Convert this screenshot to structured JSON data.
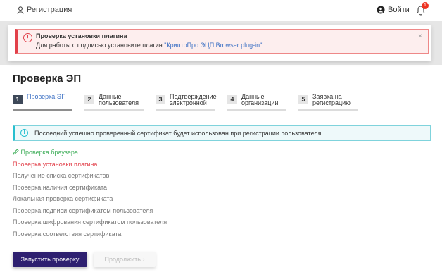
{
  "header": {
    "register_label": "Регистрация",
    "login_label": "Войти",
    "notification_count": "1"
  },
  "alert": {
    "title": "Проверка установки плагина",
    "text_prefix": "Для работы с подписью установите плагин ",
    "link_text": "\"КриптоПро ЭЦП Browser plug-in\"",
    "close": "×"
  },
  "page": {
    "title": "Проверка ЭП"
  },
  "steps": [
    {
      "num": "1",
      "label": "Проверка ЭП"
    },
    {
      "num": "2",
      "label": "Данные\nпользователя"
    },
    {
      "num": "3",
      "label": "Подтверждение\nэлектронной"
    },
    {
      "num": "4",
      "label": "Данные\nорганизации"
    },
    {
      "num": "5",
      "label": "Заявка на\nрегистрацию"
    }
  ],
  "info": {
    "text": "Последний успешно проверенный сертификат будет использован при регистрации пользователя."
  },
  "checks": [
    {
      "label": "Проверка браузера",
      "status": "ok"
    },
    {
      "label": "Проверка установки плагина",
      "status": "error"
    },
    {
      "label": "Получение списка сертификатов",
      "status": "pending"
    },
    {
      "label": "Проверка наличия сертификата",
      "status": "pending"
    },
    {
      "label": "Локальная проверка сертификата",
      "status": "pending"
    },
    {
      "label": "Проверка подписи сертификатом пользователя",
      "status": "pending"
    },
    {
      "label": "Проверка шифрования сертификатом пользователя",
      "status": "pending"
    },
    {
      "label": "Проверка соответствия сертификата",
      "status": "pending"
    }
  ],
  "buttons": {
    "start_label": "Запустить проверку",
    "continue_label": "Продолжить ›"
  },
  "colors": {
    "primary": "#2e2070",
    "error": "#e2404a",
    "success": "#3fae5a",
    "info": "#26bfcf",
    "link": "#3a6fc4"
  }
}
